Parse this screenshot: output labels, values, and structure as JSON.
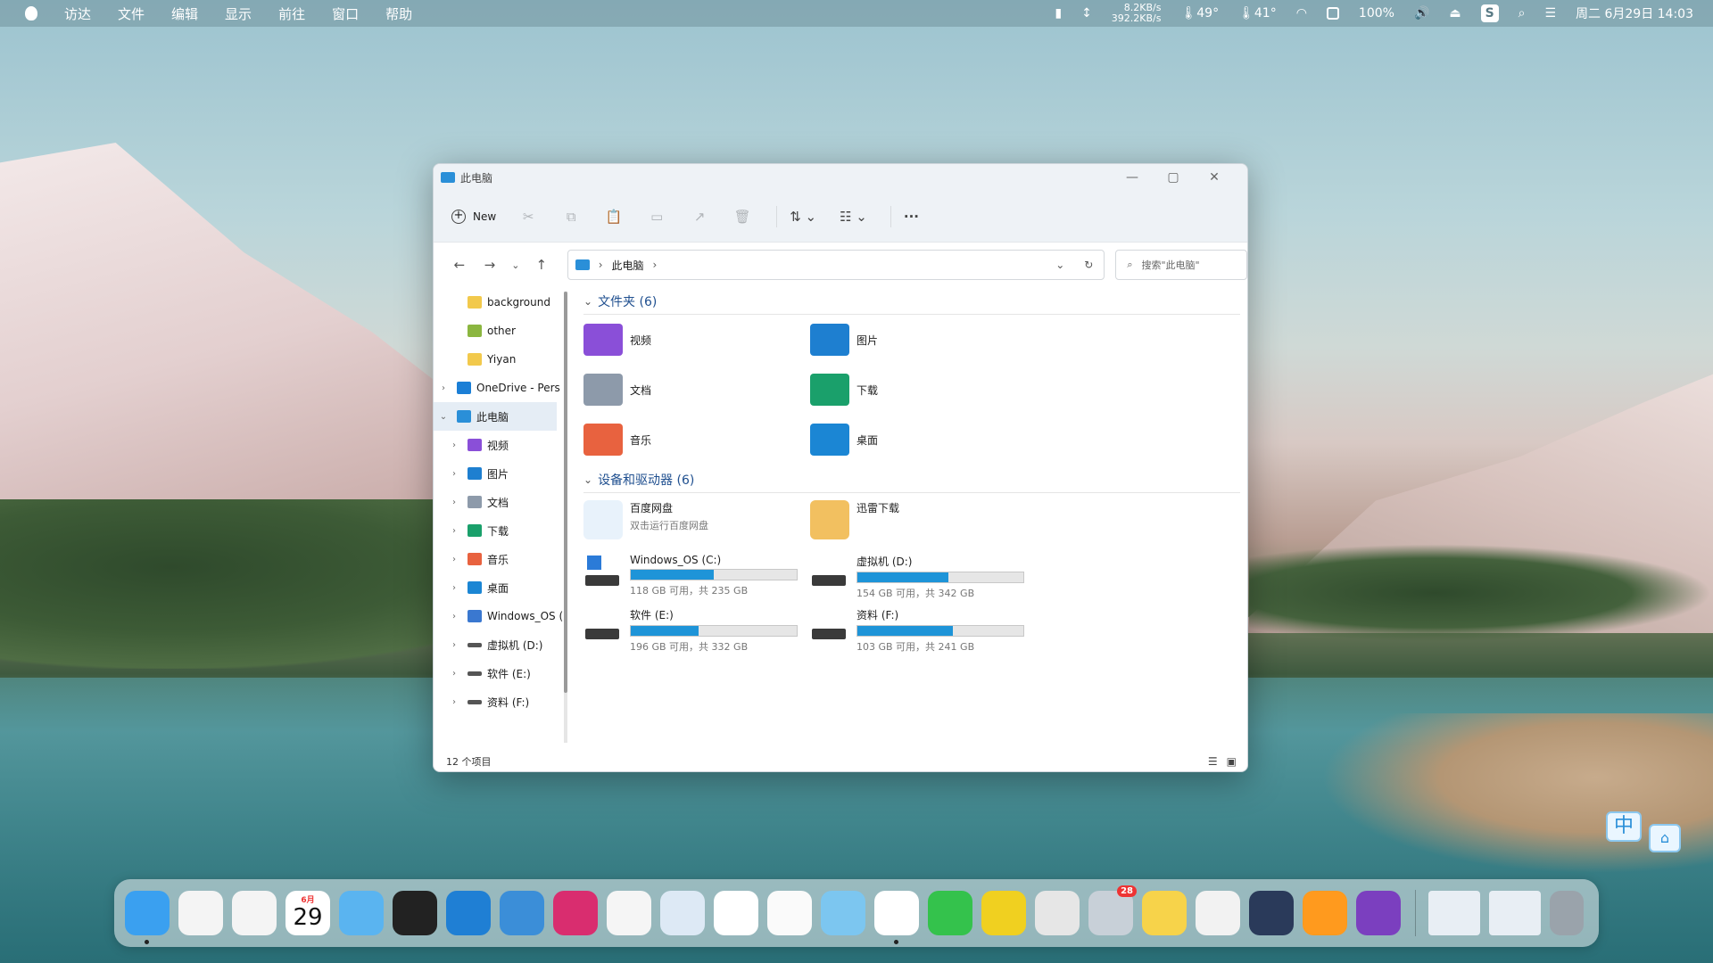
{
  "menubar": {
    "items": [
      "访达",
      "文件",
      "编辑",
      "显示",
      "前往",
      "窗口",
      "帮助"
    ],
    "net_up": "8.2KB/s",
    "net_down": "392.2KB/s",
    "temp1": "49°",
    "temp2": "41°",
    "battery": "100%",
    "datetime": "周二 6月29日 14:03"
  },
  "window": {
    "title": "此电脑",
    "new_label": "New",
    "address": "此电脑",
    "search_placeholder": "搜索\"此电脑\"",
    "status": "12 个项目"
  },
  "sidebar": {
    "items": [
      {
        "label": "background",
        "indent": 1,
        "arrow": "",
        "icon": "folder-icon",
        "color": "#f2c94c"
      },
      {
        "label": "other",
        "indent": 1,
        "arrow": "",
        "icon": "folder-sync-icon",
        "color": "#8bb640"
      },
      {
        "label": "Yiyan",
        "indent": 1,
        "arrow": "",
        "icon": "folder-icon",
        "color": "#f2c94c"
      },
      {
        "label": "OneDrive - Pers",
        "indent": 0,
        "arrow": "›",
        "icon": "cloud-icon",
        "color": "#1b7fd6"
      },
      {
        "label": "此电脑",
        "indent": 0,
        "arrow": "⌄",
        "icon": "computer-icon",
        "color": "#2a8fd8",
        "selected": true
      },
      {
        "label": "视频",
        "indent": 1,
        "arrow": "›",
        "icon": "video-folder-icon",
        "color": "#8a4fd8"
      },
      {
        "label": "图片",
        "indent": 1,
        "arrow": "›",
        "icon": "pictures-folder-icon",
        "color": "#1e7fd0"
      },
      {
        "label": "文档",
        "indent": 1,
        "arrow": "›",
        "icon": "documents-folder-icon",
        "color": "#8d9aaa"
      },
      {
        "label": "下载",
        "indent": 1,
        "arrow": "›",
        "icon": "download-icon",
        "color": "#1aa06b"
      },
      {
        "label": "音乐",
        "indent": 1,
        "arrow": "›",
        "icon": "music-folder-icon",
        "color": "#e8623f"
      },
      {
        "label": "桌面",
        "indent": 1,
        "arrow": "›",
        "icon": "desktop-folder-icon",
        "color": "#1b86d4"
      },
      {
        "label": "Windows_OS (",
        "indent": 1,
        "arrow": "›",
        "icon": "windows-drive-icon",
        "color": "#3a78d0"
      },
      {
        "label": "虚拟机 (D:)",
        "indent": 1,
        "arrow": "›",
        "icon": "drive-icon",
        "color": "#555555"
      },
      {
        "label": "软件 (E:)",
        "indent": 1,
        "arrow": "›",
        "icon": "drive-icon",
        "color": "#555555"
      },
      {
        "label": "资料 (F:)",
        "indent": 1,
        "arrow": "›",
        "icon": "drive-icon",
        "color": "#555555"
      }
    ]
  },
  "folders": {
    "header": "文件夹 (6)",
    "items": [
      {
        "label": "视频",
        "color": "#8a4fd8"
      },
      {
        "label": "图片",
        "color": "#1e7fd0"
      },
      {
        "label": "文档",
        "color": "#8d9aaa"
      },
      {
        "label": "下载",
        "color": "#1aa06b"
      },
      {
        "label": "音乐",
        "color": "#e8623f"
      },
      {
        "label": "桌面",
        "color": "#1b86d4"
      }
    ]
  },
  "devices": {
    "header": "设备和驱动器 (6)",
    "apps": [
      {
        "label": "百度网盘",
        "sub": "双击运行百度网盘"
      },
      {
        "label": "迅雷下载",
        "sub": ""
      }
    ],
    "drives": [
      {
        "label": "Windows_OS (C:)",
        "info": "118 GB 可用，共 235 GB",
        "used": 0.498
      },
      {
        "label": "虚拟机 (D:)",
        "info": "154 GB 可用，共 342 GB",
        "used": 0.55
      },
      {
        "label": "软件 (E:)",
        "info": "196 GB 可用，共 332 GB",
        "used": 0.41
      },
      {
        "label": "资料 (F:)",
        "info": "103 GB 可用，共 241 GB",
        "used": 0.573
      }
    ]
  },
  "dock": {
    "calendar_month": "6月",
    "calendar_day": "29",
    "badge": "28",
    "apps": [
      "finder",
      "launchpad",
      "xmind",
      "calendar",
      "folder",
      "clock",
      "vscode",
      "xcode-like",
      "intellij",
      "qq",
      "pycharm-like",
      "baidu-netdisk",
      "typora",
      "rss",
      "chrome",
      "wechat",
      "pdf-expert",
      "sketch-like",
      "cloud",
      "qqmusic",
      "office",
      "cat",
      "search",
      "onenote"
    ]
  }
}
